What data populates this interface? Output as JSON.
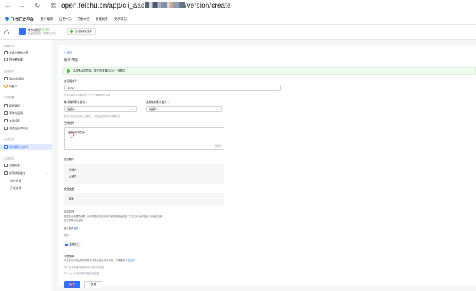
{
  "browser": {
    "url_prefix": "open.feishu.cn/app/cli_aad",
    "url_suffix": "/version/create"
  },
  "header": {
    "brand": "飞书开放平台",
    "nav": [
      "客户案例",
      "应用中心",
      "开发文档",
      "智能助手",
      "更新日志"
    ]
  },
  "app_strip": {
    "app_name": "考书创助手",
    "app_badge": "已启用",
    "app_id": "企业自建应用 · 仅开发者可见",
    "status": "当前版本已发布"
  },
  "sidebar": {
    "groups": [
      {
        "title": "基础信息",
        "items": [
          "凭证与基础信息",
          "协作者管理"
        ]
      },
      {
        "title": "应用能力",
        "items": [
          "添加应用能力",
          "机器人"
        ]
      },
      {
        "title": "开发配置",
        "items": [
          "权限管理",
          "事件与回调",
          "安全设置",
          "测试企业和人员"
        ]
      },
      {
        "title": "应用发布",
        "items": [
          "版本管理与发布"
        ]
      },
      {
        "title": "运营监控",
        "items": [
          "日志检索",
          "应用质量监控",
          "用户反馈",
          "开发反馈"
        ]
      }
    ]
  },
  "main": {
    "back": "< 返回",
    "title": "版本详情",
    "banner": "本次变动需审核，提交审核通过后可上线使用",
    "version": {
      "label": "应用版本号",
      "value": "1.0.2",
      "hint": "已有的最近发布版本号，上一个版本号是 1.0.1"
    },
    "mobile_default": {
      "label": "移动端的默认能力",
      "value": "机器人",
      "hint": "默认打开应用时进入的能力，可在后台修改为不同能力页"
    },
    "desktop_default": {
      "label": "桌面端的默认能力",
      "value": "机器人"
    },
    "notes": {
      "label": "更新说明",
      "value": "更新应用信息",
      "counter": "6/500",
      "annotation": "2"
    },
    "capabilities": {
      "label": "应用能力",
      "items": [
        "机器人",
        "已启用"
      ]
    },
    "changes": {
      "label": "权限变更",
      "value": "暂无"
    },
    "scope": {
      "label": "可用范围",
      "desc_line1": "根据企业管理员设置，可用范围内的应用用户都能看到此应用，并在工作台和搜索中找到该应用。",
      "desc_line2": "提交审核后可生效",
      "edit_row": "部分成员",
      "edit_link": "编辑",
      "sub_label": "成员",
      "chip": "全体员工"
    },
    "gray": {
      "label": "灰度发布",
      "desc": "可在不影响线上用户的情况下先给部分用户试用，了解更多",
      "desc_link": "开发文档",
      "opt1": "允许机器人使用功能中的消息推送",
      "opt2": "app 会将应用内容推送至机器人"
    },
    "buttons": {
      "save": "保存",
      "cancel": "取消",
      "annotation": "3"
    }
  },
  "colors": {
    "primary": "#3370ff",
    "success": "#34c724",
    "danger": "#f54a45",
    "annotation": "#e0312a"
  }
}
